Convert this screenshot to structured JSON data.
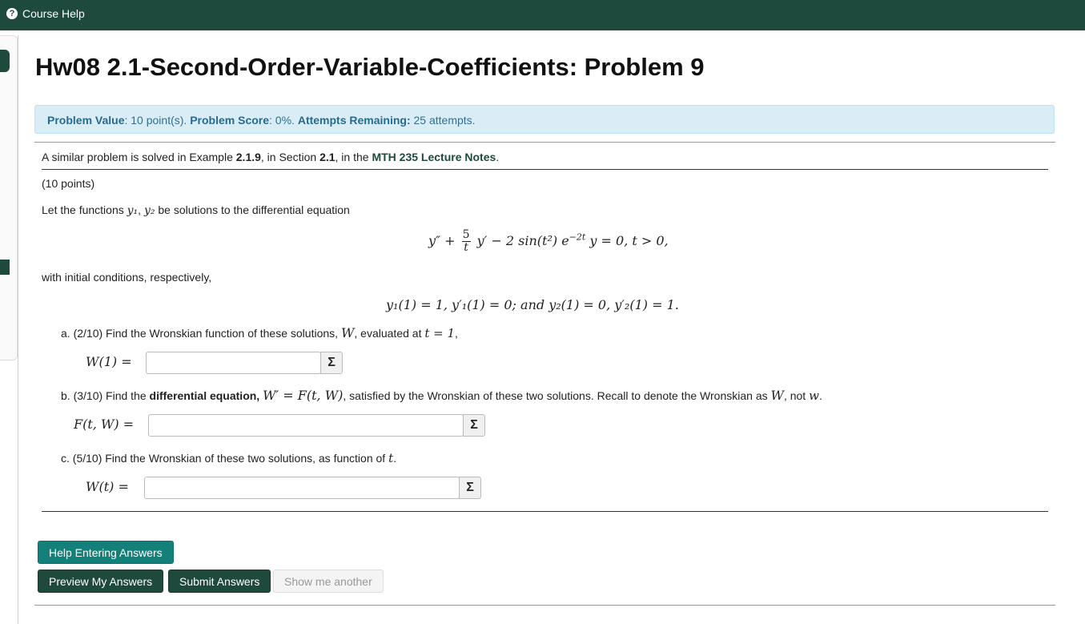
{
  "topbar": {
    "help_icon": "?",
    "course_help": "Course Help"
  },
  "page": {
    "title": "Hw08 2.1-Second-Order-Variable-Coefficients: Problem 9"
  },
  "info": {
    "value_label": "Problem Value",
    "value_text": ": 10 point(s).",
    "score_label": "Problem Score",
    "score_text": ": 0%.",
    "attempts_label": "Attempts Remaining:",
    "attempts_text": "25 attempts."
  },
  "problem": {
    "ref_pre": "A similar problem is solved in Example ",
    "ref_example": "2.1.9",
    "ref_mid": ", in Section ",
    "ref_section": "2.1",
    "ref_mid2": ", in the ",
    "ref_notes": "MTH 235 Lecture Notes",
    "ref_end": ".",
    "points": "(10 points)",
    "intro": "Let the functions",
    "intro_y1": "y₁",
    "intro_sep": ", ",
    "intro_y2": "y₂",
    "intro_end": "be solutions to the differential equation",
    "eq_lhs": "y″ +",
    "eq_num": "5",
    "eq_den": "t",
    "eq_mid": "y′ − 2 sin(t²) e",
    "eq_exp": "−2t",
    "eq_rhs": "y = 0,     t > 0,",
    "initial": "with initial conditions, respectively,",
    "ic_text": "y₁(1) = 1,    y′₁(1) = 0;    and    y₂(1) = 0,    y′₂(1) = 1."
  },
  "part_a": {
    "prefix": "a. (2/10) Find the Wronskian function of these solutions,",
    "var": "W",
    "mid": ", evaluated at",
    "cond": "t = 1",
    "end": ",",
    "label": "W(1) =",
    "value": ""
  },
  "part_b": {
    "prefix": "b. (3/10) Find the ",
    "bold": "differential equation,",
    "eq": "W′ = F(t, W)",
    "mid": ", satisfied by the Wronskian of these two solutions. Recall to denote the Wronskian as",
    "var": "W",
    "mid2": ", not",
    "var2": "w",
    "end": ".",
    "label": "F(t, W) =",
    "value": ""
  },
  "part_c": {
    "prefix": "c. (5/10) Find the Wronskian of these two solutions, as function of",
    "var": "t",
    "end": ".",
    "label": "W(t) =",
    "value": ""
  },
  "equation_editor": {
    "glyph": "Σ"
  },
  "buttons": {
    "help": "Help Entering Answers",
    "preview": "Preview My Answers",
    "submit": "Submit Answers",
    "another": "Show me another"
  }
}
